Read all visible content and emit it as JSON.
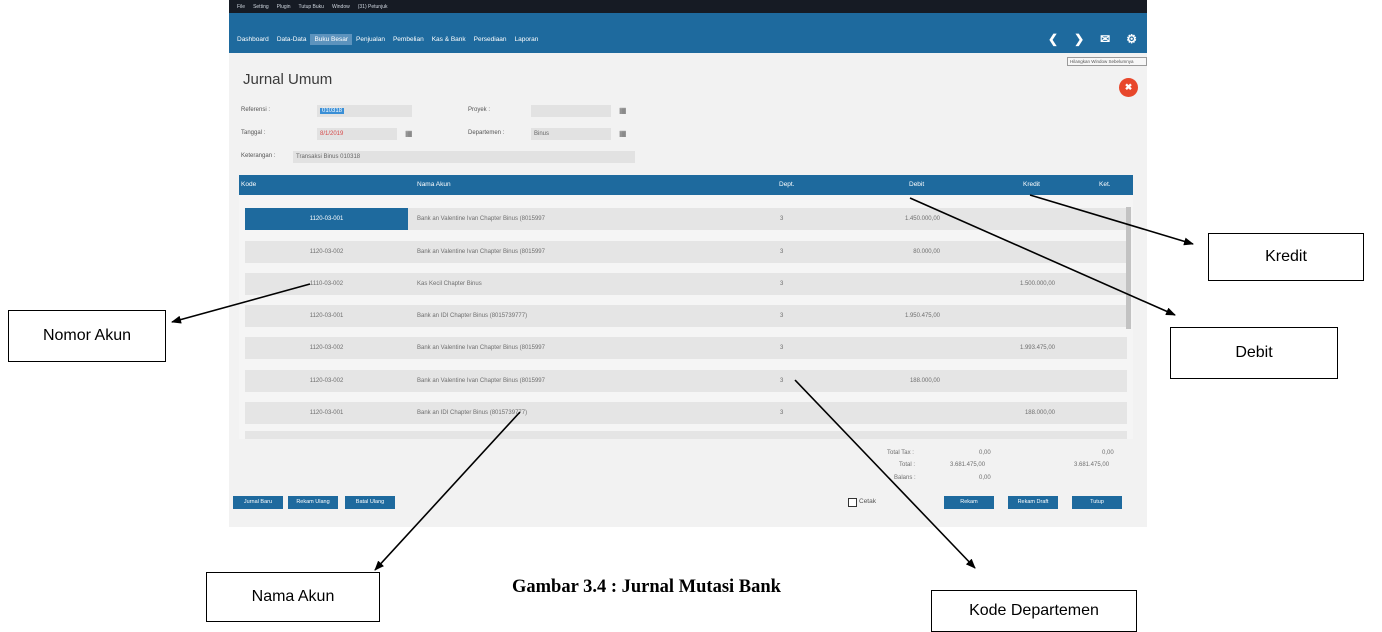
{
  "menubar": {
    "items": [
      "File",
      "Setting",
      "Plugin",
      "Tutup Buku",
      "Window",
      "(31) Petunjuk"
    ]
  },
  "navbar": {
    "items": [
      "Dashboard",
      "Data-Data",
      "Buku Besar",
      "Penjualan",
      "Pembelian",
      "Kas & Bank",
      "Persediaan",
      "Laporan"
    ],
    "active": "Buku Besar",
    "icons": [
      "back-icon",
      "forward-icon",
      "mail-icon",
      "gear-icon"
    ]
  },
  "tooltip": "Hilangkan Window Sebelumnya",
  "page": {
    "title": "Jurnal Umum"
  },
  "form": {
    "referensi_label": "Referensi :",
    "referensi_value": "010318",
    "tanggal_label": "Tanggal :",
    "tanggal_value": "8/1/2019",
    "keterangan_label": "Keterangan :",
    "keterangan_value": "Transaksi Binus 010318",
    "proyek_label": "Proyek :",
    "proyek_value": "",
    "departemen_label": "Departemen :",
    "departemen_value": "Binus"
  },
  "table": {
    "headers": {
      "kode": "Kode",
      "nama": "Nama Akun",
      "dept": "Dept.",
      "debit": "Debit",
      "kredit": "Kredit",
      "ket": "Ket."
    },
    "rows": [
      {
        "kode": "1120-03-001",
        "nama": "Bank an Valentine Ivan Chapter Binus (8015997",
        "dept": "3",
        "debit": "1.450.000,00",
        "kredit": ""
      },
      {
        "kode": "1120-03-002",
        "nama": "Bank an Valentine Ivan Chapter Binus (8015997",
        "dept": "3",
        "debit": "80.000,00",
        "kredit": ""
      },
      {
        "kode": "1110-03-002",
        "nama": "Kas Kecil Chapter Binus",
        "dept": "3",
        "debit": "",
        "kredit": "1.500.000,00"
      },
      {
        "kode": "1120-03-001",
        "nama": "Bank an IDI Chapter Binus (8015739777)",
        "dept": "3",
        "debit": "1.950.475,00",
        "kredit": ""
      },
      {
        "kode": "1120-03-002",
        "nama": "Bank an Valentine Ivan Chapter Binus (8015997",
        "dept": "3",
        "debit": "",
        "kredit": "1.993.475,00"
      },
      {
        "kode": "1120-03-002",
        "nama": "Bank an Valentine Ivan Chapter Binus (8015997",
        "dept": "3",
        "debit": "188.000,00",
        "kredit": ""
      },
      {
        "kode": "1120-03-001",
        "nama": "Bank an IDI Chapter Binus (8015739777)",
        "dept": "3",
        "debit": "",
        "kredit": "188.000,00"
      }
    ]
  },
  "totals": {
    "total_tax_label": "Total Tax :",
    "total_tax_debit": "0,00",
    "total_tax_kredit": "0,00",
    "total_label": "Total :",
    "total_debit": "3.681.475,00",
    "total_kredit": "3.681.475,00",
    "balans_label": "Balans :",
    "balans_value": "0,00"
  },
  "buttons": {
    "left": [
      "Jurnal Baru",
      "Rekam Ulang",
      "Batal Ulang"
    ],
    "cetak": "Cetak",
    "right": [
      "Rekam",
      "Rekam Draft",
      "Tutup"
    ]
  },
  "annotations": {
    "kredit": "Kredit",
    "debit": "Debit",
    "nomor_akun": "Nomor Akun",
    "nama_akun": "Nama Akun",
    "kode_departemen": "Kode Departemen"
  },
  "caption": "Gambar 3.4 : Jurnal Mutasi Bank"
}
